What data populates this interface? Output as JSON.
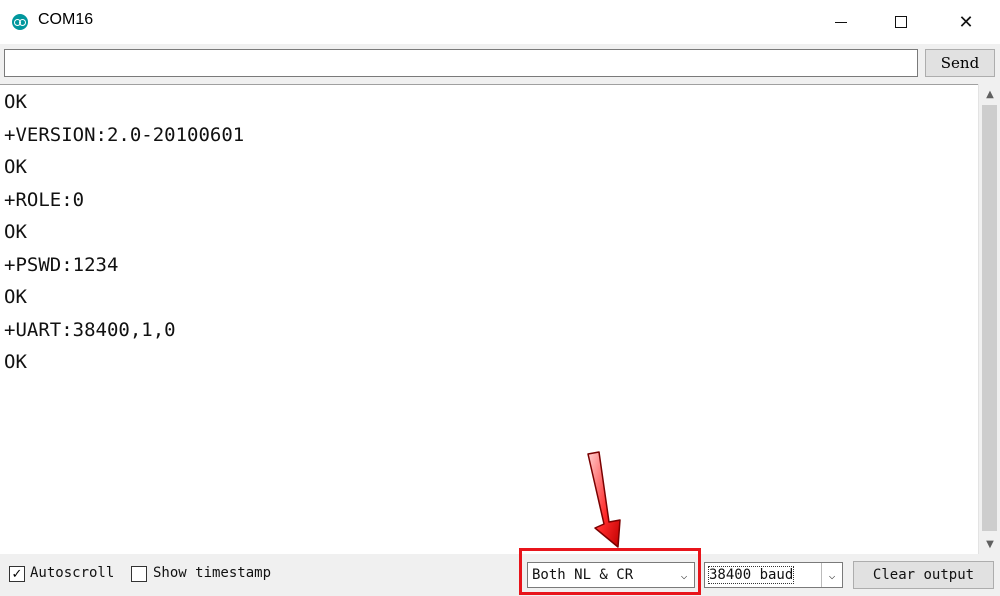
{
  "window": {
    "title": "COM16",
    "controls": {
      "minimize": "–",
      "maximize": "□",
      "close": "✕"
    }
  },
  "send": {
    "input_value": "",
    "button_label": "Send"
  },
  "output": {
    "lines": [
      "OK",
      "+VERSION:2.0-20100601",
      "OK",
      "+ROLE:0",
      "OK",
      "+PSWD:1234",
      "OK",
      "+UART:38400,1,0",
      "OK"
    ]
  },
  "bottom": {
    "autoscroll": {
      "label": "Autoscroll",
      "checked": true
    },
    "timestamp": {
      "label": "Show timestamp",
      "checked": false
    },
    "line_ending": "Both NL & CR",
    "baud": "38400 baud",
    "clear_label": "Clear output"
  },
  "annotation": {
    "color": "#e8141b",
    "icon": "red-arrow"
  },
  "colors": {
    "app_icon": "#00979d"
  }
}
